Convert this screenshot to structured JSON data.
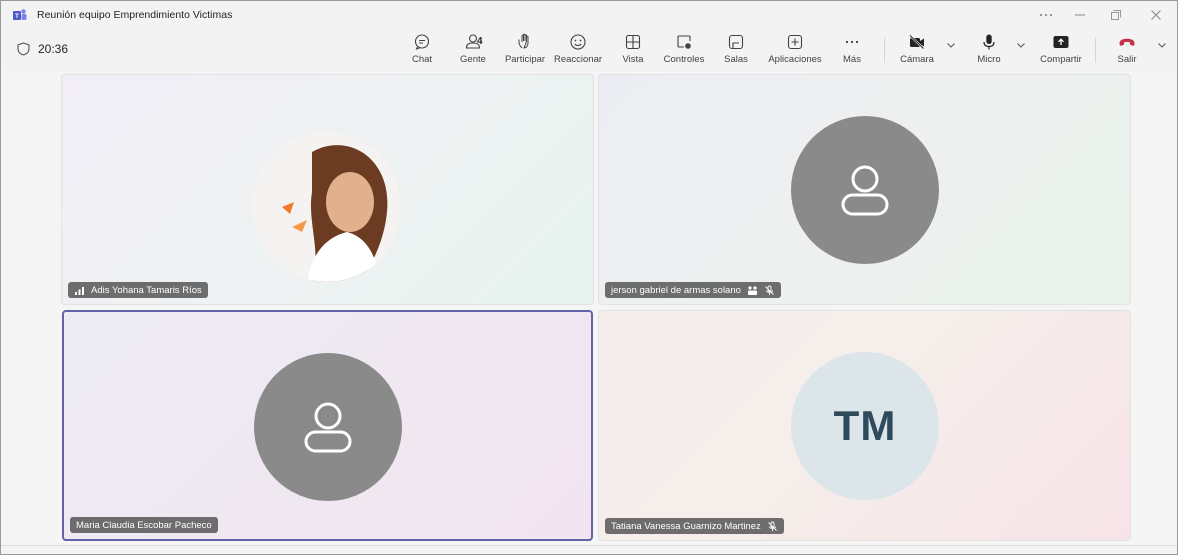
{
  "window": {
    "title": "Reunión equipo Emprendimiento Victimas",
    "icons": [
      "teams-logo",
      "more-icon",
      "minimize-icon",
      "restore-icon",
      "close-icon"
    ]
  },
  "toolbar": {
    "timer": "20:36",
    "people_count": "4",
    "items": {
      "chat": "Chat",
      "people": "Gente",
      "raise": "Participar",
      "react": "Reaccionar",
      "view": "Vista",
      "controls": "Controles",
      "rooms": "Salas",
      "apps": "Aplicaciones",
      "more": "Más",
      "camera": "Cámara",
      "mic": "Micro",
      "share": "Compartir",
      "leave": "Salir"
    },
    "colors": {
      "leave": "#c4314b",
      "accent": "#6264a7"
    }
  },
  "participants": [
    {
      "name": "Adis Yohana Tamaris Ríos",
      "avatar": "photo",
      "indicator": "signal-icon"
    },
    {
      "name": "jerson gabriel de armas solano",
      "avatar": "person-icon",
      "indicator": "mic-off-icon"
    },
    {
      "name": "Maria Claudia Escobar Pacheco",
      "avatar": "person-icon",
      "active_speaker": true
    },
    {
      "name": "Tatiana Vanessa Guarnizo Martinez",
      "avatar": "initials",
      "initials": "TM",
      "indicator": "mic-off-icon"
    }
  ]
}
